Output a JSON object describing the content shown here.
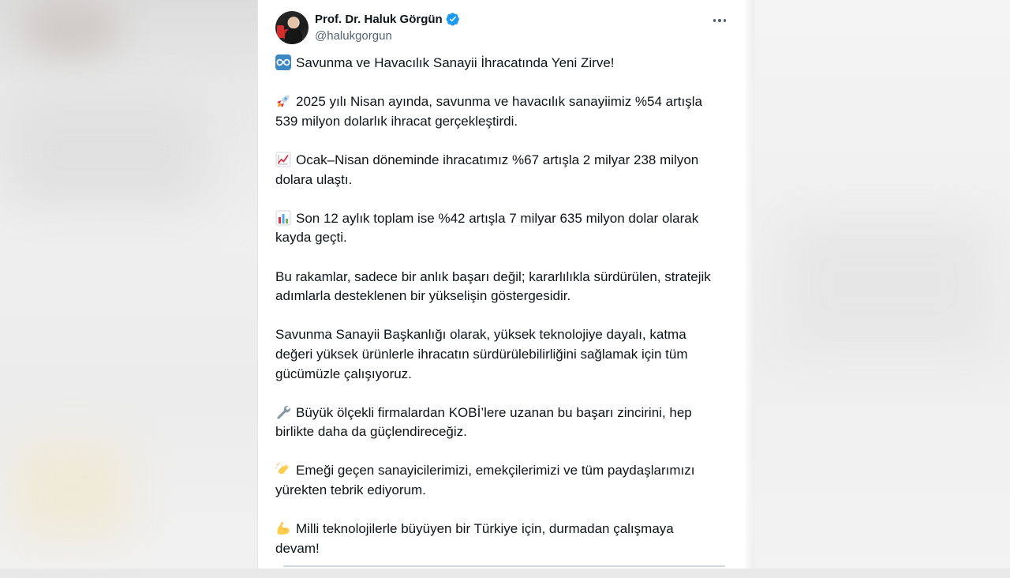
{
  "author": {
    "display_name": "Prof. Dr. Haluk Görgün",
    "handle": "@halukgorgun",
    "verified": true
  },
  "post": {
    "paragraphs": [
      {
        "emoji": "infinity-icon",
        "text": "Savunma ve Havacılık Sanayii İhracatında Yeni Zirve!"
      },
      {
        "emoji": "rocket-icon",
        "text": "2025 yılı Nisan ayında, savunma ve havacılık sanayiimiz %54 artışla\n539 milyon dolarlık ihracat gerçekleştirdi."
      },
      {
        "emoji": "chart-increasing-icon",
        "text": "Ocak–Nisan döneminde ihracatımız %67 artışla 2 milyar 238 milyon\ndolara ulaştı."
      },
      {
        "emoji": "bar-chart-icon",
        "text": "Son 12 aylık toplam ise %42 artışla 7 milyar 635 milyon dolar olarak\nkayda geçti."
      },
      {
        "emoji": null,
        "text": "Bu rakamlar, sadece bir anlık başarı değil; kararlılıkla sürdürülen, stratejik\nadımlarla desteklenen bir yükselişin göstergesidir."
      },
      {
        "emoji": null,
        "text": "Savunma Sanayii Başkanlığı olarak, yüksek teknolojiye dayalı, katma\ndeğeri yüksek ürünlerle ihracatın sürdürülebilirliğini sağlamak için tüm\ngücümüzle çalışıyoruz."
      },
      {
        "emoji": "wrench-icon",
        "text": "Büyük ölçekli firmalardan KOBİ’lere uzanan bu başarı zincirini, hep\nbirlikte daha da güçlendireceğiz."
      },
      {
        "emoji": "clapping-hands-icon",
        "text": "Emeği geçen sanayicilerimizi, emekçilerimizi ve tüm paydaşlarımızı\nyürekten tebrik ediyorum."
      },
      {
        "emoji": "flexed-biceps-icon",
        "text": "Milli teknolojilerle büyüyen bir Türkiye için, durmadan çalışmaya\ndevam!"
      }
    ]
  },
  "colors": {
    "text": "#0f1419",
    "secondary_text": "#536471",
    "verified_badge": "#1d9bf0"
  }
}
